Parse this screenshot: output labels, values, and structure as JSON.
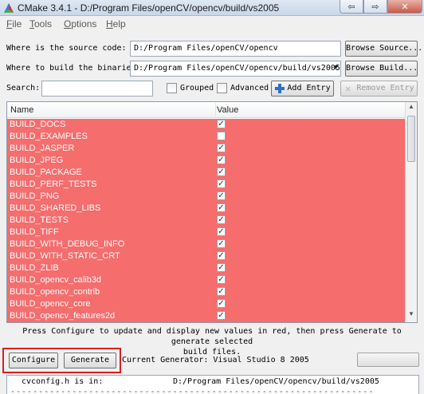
{
  "window": {
    "title": "CMake 3.4.1 - D:/Program Files/openCV/opencv/build/vs2005",
    "minimize": "⇦",
    "restore": "⇨",
    "close": "✕"
  },
  "menu": [
    {
      "accel": "F",
      "rest": "ile"
    },
    {
      "accel": "T",
      "rest": "ools"
    },
    {
      "accel": "O",
      "rest": "ptions"
    },
    {
      "accel": "H",
      "rest": "elp"
    }
  ],
  "source": {
    "label": "Where is the source code:",
    "value": "D:/Program Files/openCV/opencv",
    "browse": "Browse Source..."
  },
  "binaries": {
    "label": "Where to build the binaries:",
    "value": "D:/Program Files/openCV/opencv/build/vs2005",
    "browse": "Browse Build..."
  },
  "search": {
    "label": "Search:",
    "value": "",
    "grouped": "Grouped",
    "advanced": "Advanced",
    "add_entry": "Add Entry",
    "remove_entry": "Remove Entry"
  },
  "table": {
    "col_name": "Name",
    "col_value": "Value",
    "row_color": "#f56d6d",
    "rows": [
      {
        "name": "BUILD_DOCS",
        "checked": true
      },
      {
        "name": "BUILD_EXAMPLES",
        "checked": false
      },
      {
        "name": "BUILD_JASPER",
        "checked": true
      },
      {
        "name": "BUILD_JPEG",
        "checked": true
      },
      {
        "name": "BUILD_PACKAGE",
        "checked": true
      },
      {
        "name": "BUILD_PERF_TESTS",
        "checked": true
      },
      {
        "name": "BUILD_PNG",
        "checked": true
      },
      {
        "name": "BUILD_SHARED_LIBS",
        "checked": true
      },
      {
        "name": "BUILD_TESTS",
        "checked": true
      },
      {
        "name": "BUILD_TIFF",
        "checked": true
      },
      {
        "name": "BUILD_WITH_DEBUG_INFO",
        "checked": true
      },
      {
        "name": "BUILD_WITH_STATIC_CRT",
        "checked": true
      },
      {
        "name": "BUILD_ZLIB",
        "checked": true
      },
      {
        "name": "BUILD_opencv_calib3d",
        "checked": true
      },
      {
        "name": "BUILD_opencv_contrib",
        "checked": true
      },
      {
        "name": "BUILD_opencv_core",
        "checked": true
      },
      {
        "name": "BUILD_opencv_features2d",
        "checked": true
      }
    ]
  },
  "hint": {
    "line1": "Press Configure to update and display new values in red, then press Generate to generate selected",
    "line2": "build files."
  },
  "actions": {
    "configure": "Configure",
    "generate": "Generate",
    "generator": "Current Generator: Visual Studio 8 2005"
  },
  "output": {
    "label": "cvconfig.h is in:",
    "path": "D:/Program Files/openCV/opencv/build/vs2005",
    "divider": "-----------------------------------------------------------------"
  }
}
